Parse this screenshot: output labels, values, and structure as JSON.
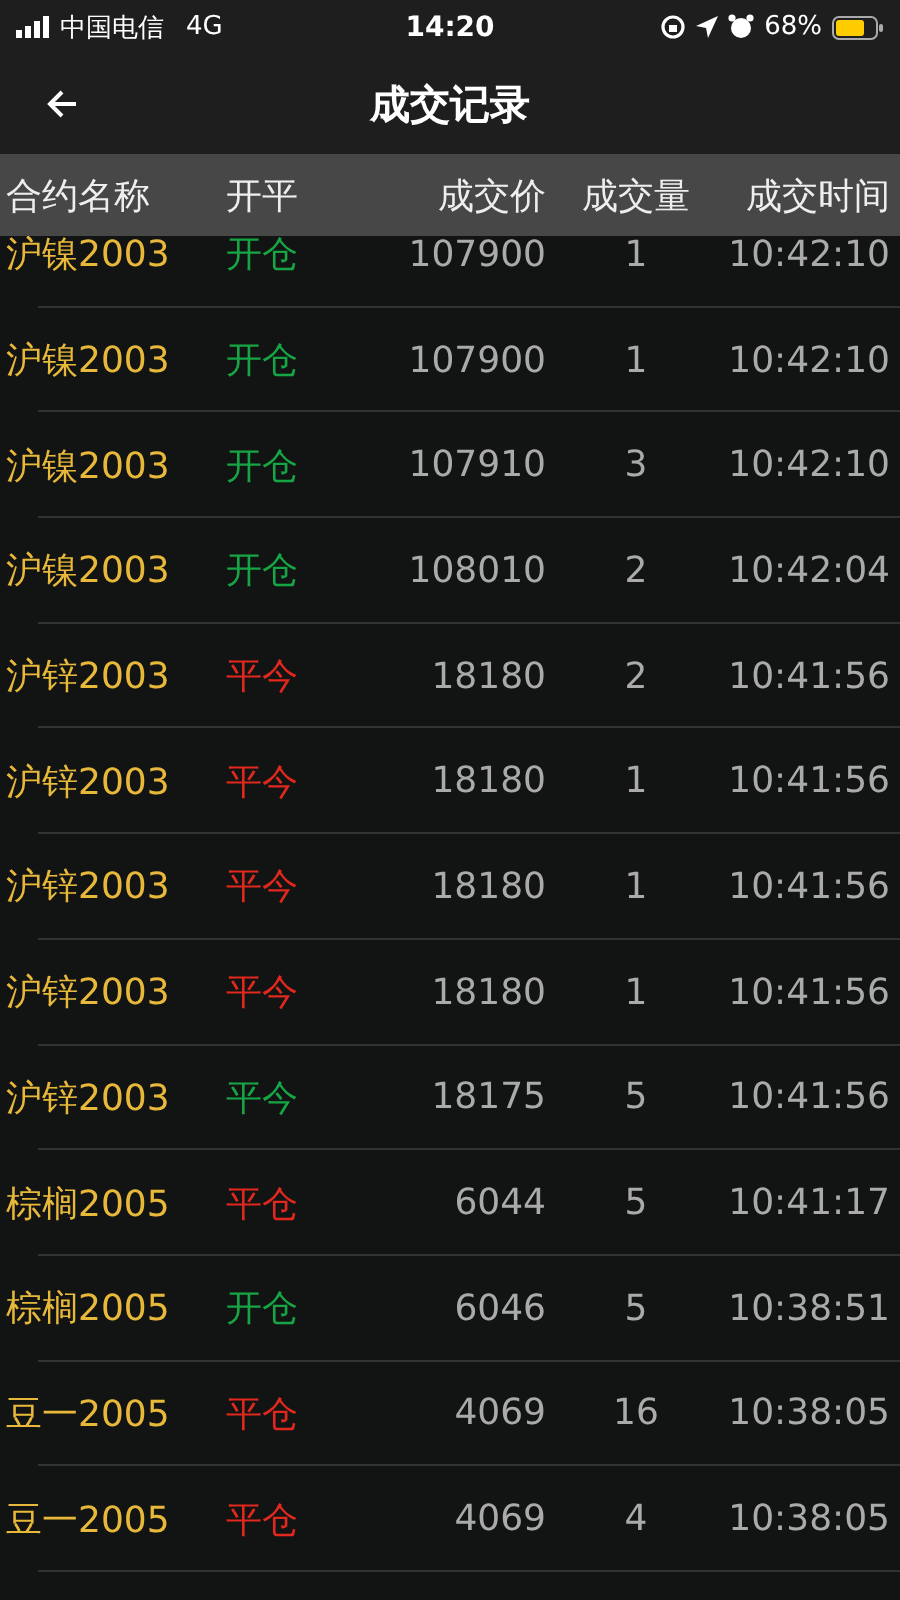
{
  "status_bar": {
    "carrier": "中国电信",
    "network": "4G",
    "time": "14:20",
    "battery": "68%"
  },
  "nav": {
    "title": "成交记录"
  },
  "table": {
    "columns": [
      "合约名称",
      "开平",
      "成交价",
      "成交量",
      "成交时间"
    ],
    "rows": [
      {
        "name": "沪镍2003",
        "action": "开仓",
        "color": "#17a444",
        "price": "107900",
        "volume": "1",
        "time": "10:42:10"
      },
      {
        "name": "沪镍2003",
        "action": "开仓",
        "color": "#17a444",
        "price": "107900",
        "volume": "1",
        "time": "10:42:10"
      },
      {
        "name": "沪镍2003",
        "action": "开仓",
        "color": "#17a444",
        "price": "107910",
        "volume": "3",
        "time": "10:42:10"
      },
      {
        "name": "沪镍2003",
        "action": "开仓",
        "color": "#17a444",
        "price": "108010",
        "volume": "2",
        "time": "10:42:04"
      },
      {
        "name": "沪锌2003",
        "action": "平今",
        "color": "#e0281e",
        "price": "18180",
        "volume": "2",
        "time": "10:41:56"
      },
      {
        "name": "沪锌2003",
        "action": "平今",
        "color": "#e0281e",
        "price": "18180",
        "volume": "1",
        "time": "10:41:56"
      },
      {
        "name": "沪锌2003",
        "action": "平今",
        "color": "#e0281e",
        "price": "18180",
        "volume": "1",
        "time": "10:41:56"
      },
      {
        "name": "沪锌2003",
        "action": "平今",
        "color": "#e0281e",
        "price": "18180",
        "volume": "1",
        "time": "10:41:56"
      },
      {
        "name": "沪锌2003",
        "action": "平今",
        "color": "#17a444",
        "price": "18175",
        "volume": "5",
        "time": "10:41:56"
      },
      {
        "name": "棕榈2005",
        "action": "平仓",
        "color": "#e0281e",
        "price": "6044",
        "volume": "5",
        "time": "10:41:17"
      },
      {
        "name": "棕榈2005",
        "action": "开仓",
        "color": "#17a444",
        "price": "6046",
        "volume": "5",
        "time": "10:38:51"
      },
      {
        "name": "豆一2005",
        "action": "平仓",
        "color": "#e0281e",
        "price": "4069",
        "volume": "16",
        "time": "10:38:05"
      },
      {
        "name": "豆一2005",
        "action": "平仓",
        "color": "#e0281e",
        "price": "4069",
        "volume": "4",
        "time": "10:38:05"
      }
    ]
  }
}
